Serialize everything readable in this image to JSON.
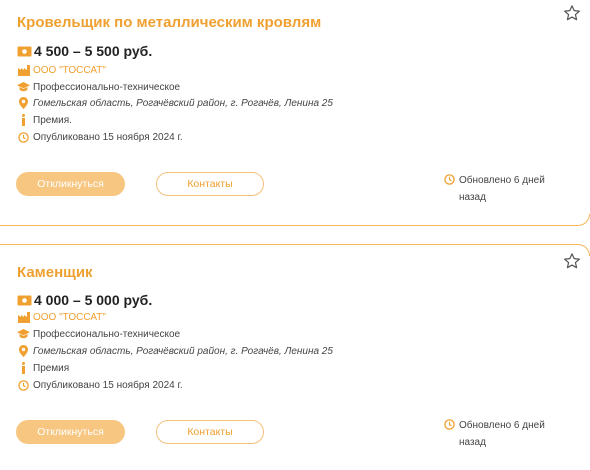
{
  "vacancies": [
    {
      "title": "Кровельщик по металлическим кровлям",
      "salary": "4 500 – 5 500 руб.",
      "company": "ООО \"ТОССАТ\"",
      "education": "Профессионально-техническое",
      "address": "Гомельская область, Рогачёвский район, г. Рогачёв, Ленина 25",
      "extra": "Премия.",
      "published": "Опубликовано 15 ноября 2024 г.",
      "apply_label": "Откликнуться",
      "contacts_label": "Контакты",
      "updated": "Обновлено 6 дней назад"
    },
    {
      "title": "Каменщик",
      "salary": "4 000 – 5 000 руб.",
      "company": "ООО \"ТОССАТ\"",
      "education": "Профессионально-техническое",
      "address": "Гомельская область, Рогачёвский район, г. Рогачёв, Ленина 25",
      "extra": "Премия",
      "published": "Опубликовано 15 ноября 2024 г.",
      "apply_label": "Откликнуться",
      "contacts_label": "Контакты",
      "updated": "Обновлено 6 дней назад"
    }
  ],
  "colors": {
    "accent": "#f0a030",
    "button_fill": "#f7c680",
    "border": "#f5b65c"
  },
  "icons": [
    "star-icon",
    "money-icon",
    "factory-icon",
    "graduation-cap-icon",
    "location-pin-icon",
    "info-icon",
    "clock-icon"
  ]
}
